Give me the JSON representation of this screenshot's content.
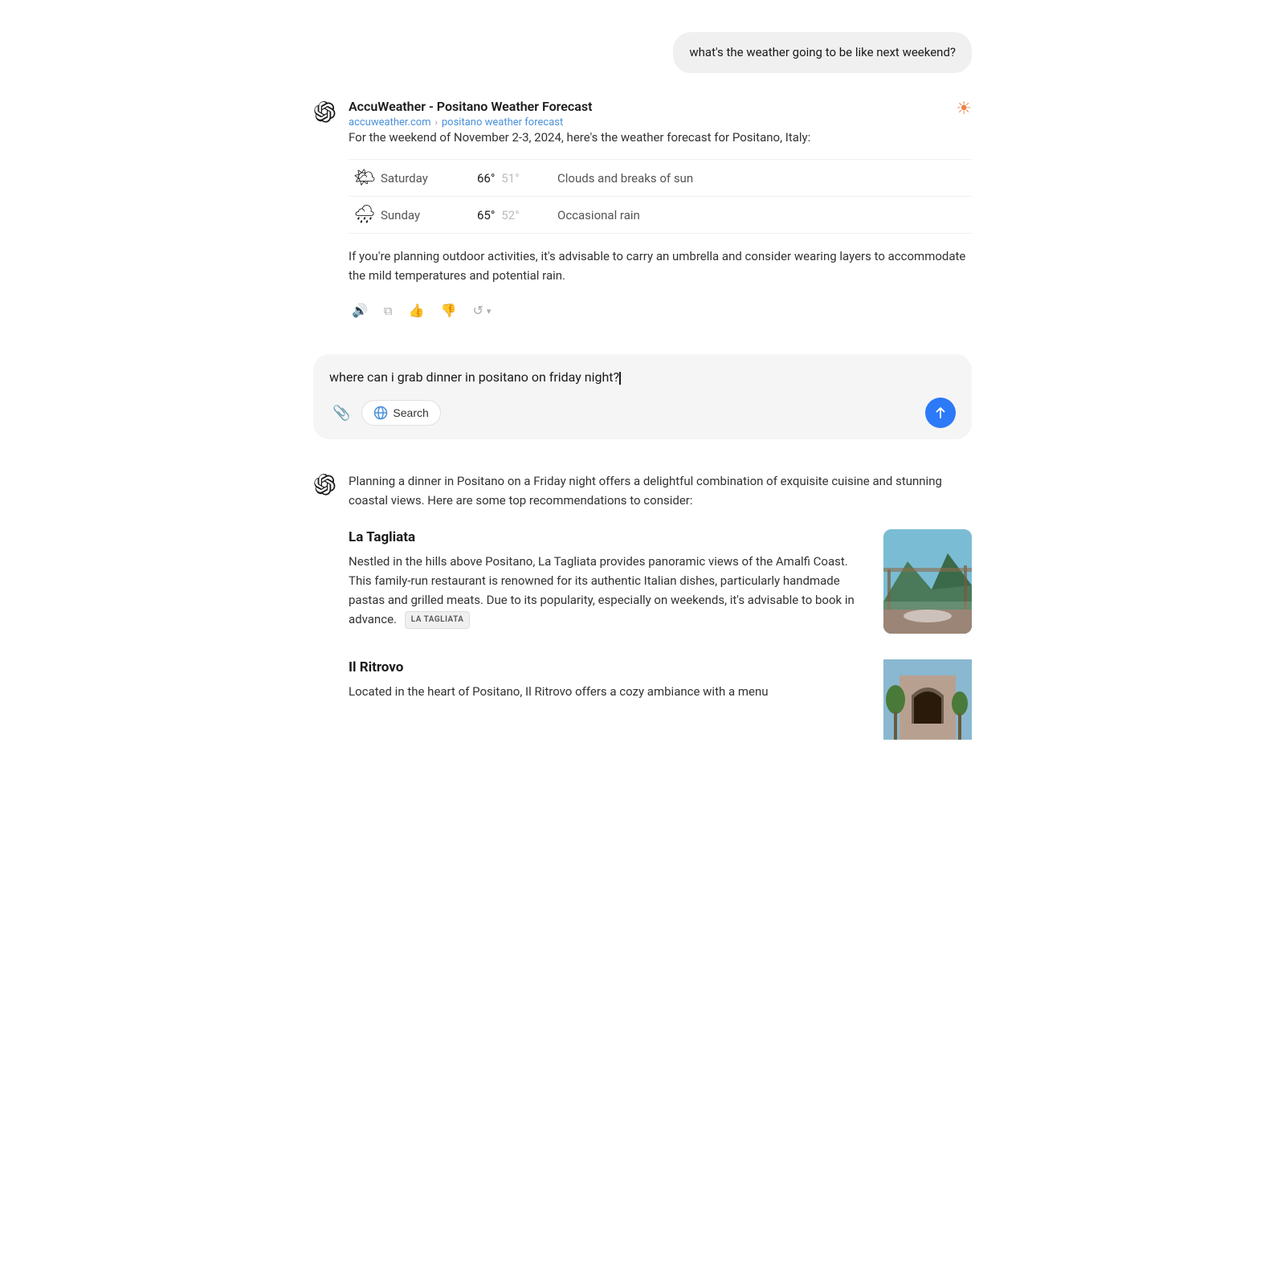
{
  "user_message_1": {
    "text": "what's the weather going to be like next weekend?"
  },
  "ai_response_1": {
    "source_title": "AccuWeather - Positano Weather Forecast",
    "source_domain": "accuweather.com",
    "source_path": "positano weather forecast",
    "intro": "For the weekend of November 2-3, 2024, here's the weather forecast for Positano, Italy:",
    "weather_rows": [
      {
        "day": "Saturday",
        "icon": "partly-cloudy",
        "high": "66°",
        "low": "51°",
        "description": "Clouds and breaks of sun"
      },
      {
        "day": "Sunday",
        "icon": "rain",
        "high": "65°",
        "low": "52°",
        "description": "Occasional rain"
      }
    ],
    "advice": "If you're planning outdoor activities, it's advisable to carry an umbrella and consider wearing layers to accommodate the mild temperatures and potential rain."
  },
  "input_field": {
    "text": "where can i grab dinner in positano on friday night?",
    "attach_label": "Attach",
    "search_label": "Search",
    "send_label": "Send"
  },
  "ai_response_2": {
    "intro": "Planning a dinner in Positano on a Friday night offers a delightful combination of exquisite cuisine and stunning coastal views. Here are some top recommendations to consider:",
    "restaurants": [
      {
        "name": "La Tagliata",
        "description": "Nestled in the hills above Positano, La Tagliata provides panoramic views of the Amalfi Coast. This family-run restaurant is renowned for its authentic Italian dishes, particularly handmade pastas and grilled meats. Due to its popularity, especially on weekends, it's advisable to book in advance.",
        "tag": "LA TAGLIATA"
      },
      {
        "name": "Il Ritrovo",
        "description": "Located in the heart of Positano, Il Ritrovo offers a cozy ambiance with a menu",
        "tag": ""
      }
    ]
  },
  "actions": {
    "speak": "🔊",
    "copy": "⧉",
    "thumbup": "👍",
    "thumbdown": "👎",
    "refresh": "↺"
  }
}
